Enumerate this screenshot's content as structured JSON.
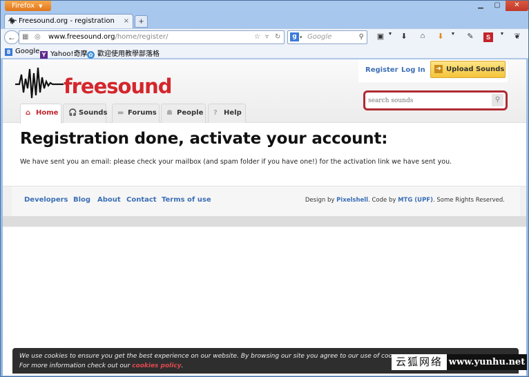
{
  "browser": {
    "app_button": "Firefox",
    "tab_title": "Freesound.org - registration done",
    "url_host": "www.freesound.org",
    "url_path": "/home/register/",
    "search_engine": "Google",
    "search_placeholder": "Google"
  },
  "bookmarks": [
    {
      "label": "Google",
      "icon": "google-icon"
    },
    {
      "label": "Yahoo!奇摩",
      "icon": "yahoo-icon"
    },
    {
      "label": "歡迎使用教學部落格",
      "icon": "blog-icon"
    }
  ],
  "site": {
    "logo_text": "freesound",
    "brand_color": "#d4262c",
    "top_links": {
      "register": "Register",
      "login": "Log In"
    },
    "upload_label": "Upload Sounds",
    "search_placeholder": "search sounds",
    "nav": [
      {
        "label": "Home",
        "icon": "home-icon",
        "active": true
      },
      {
        "label": "Sounds",
        "icon": "headphones-icon"
      },
      {
        "label": "Forums",
        "icon": "chat-icon"
      },
      {
        "label": "People",
        "icon": "people-icon"
      },
      {
        "label": "Help",
        "icon": "help-icon"
      }
    ]
  },
  "main": {
    "title": "Registration done, activate your account:",
    "text": "We have sent you an email: please check your mailbox (and spam folder if you have one!) for the activation link we have sent you."
  },
  "footer": {
    "links": [
      "Developers",
      "Blog",
      "About",
      "Contact",
      "Terms of use"
    ],
    "design_prefix": "Design by ",
    "design_by": "Pixelshell",
    "code_prefix": ". Code by ",
    "code_by": "MTG (UPF)",
    "rights": ". Some Rights Reserved."
  },
  "cookie": {
    "line1": "We use cookies to ensure you get the best experience on our website. By browsing our site you agree to our use of coo",
    "line2_prefix": "For more information check out our ",
    "policy_link": "cookies policy",
    "line2_suffix": "."
  },
  "watermark": {
    "cn": "云狐网络",
    "url": "www.yunhu.net"
  }
}
